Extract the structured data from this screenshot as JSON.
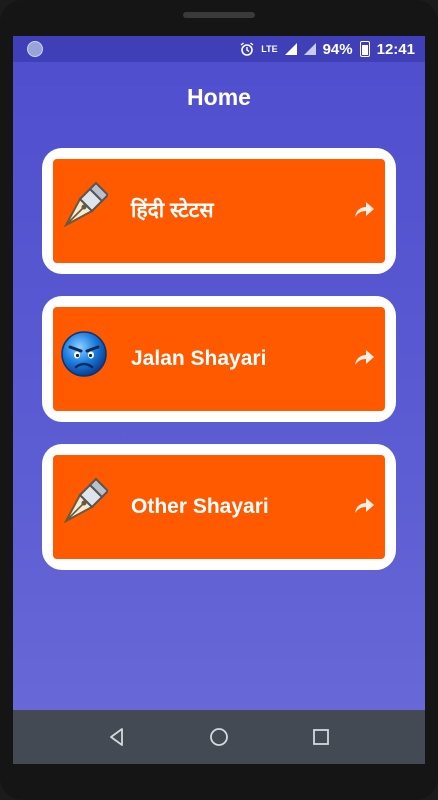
{
  "status_bar": {
    "battery_percent": "94%",
    "time": "12:41",
    "network_label": "LTE",
    "icons": [
      "app-notification-icon",
      "alarm-icon",
      "lte-icon",
      "signal-icon",
      "battery-charging-icon"
    ]
  },
  "header": {
    "title": "Home"
  },
  "menu": {
    "items": [
      {
        "label": "हिंदी स्टेटस",
        "icon": "pen-nib-icon"
      },
      {
        "label": "Jalan Shayari",
        "icon": "angry-face-icon"
      },
      {
        "label": "Other Shayari",
        "icon": "pen-nib-icon"
      }
    ],
    "arrow_icon": "share-arrow-icon"
  },
  "colors": {
    "background_top": "#4f4fcf",
    "background_bottom": "#6a6ad8",
    "card_border": "#ffffff",
    "card_fill": "#ff5a00",
    "navbar": "#444a53"
  },
  "navbar": {
    "buttons": [
      "back-icon",
      "home-icon",
      "recents-icon"
    ]
  }
}
